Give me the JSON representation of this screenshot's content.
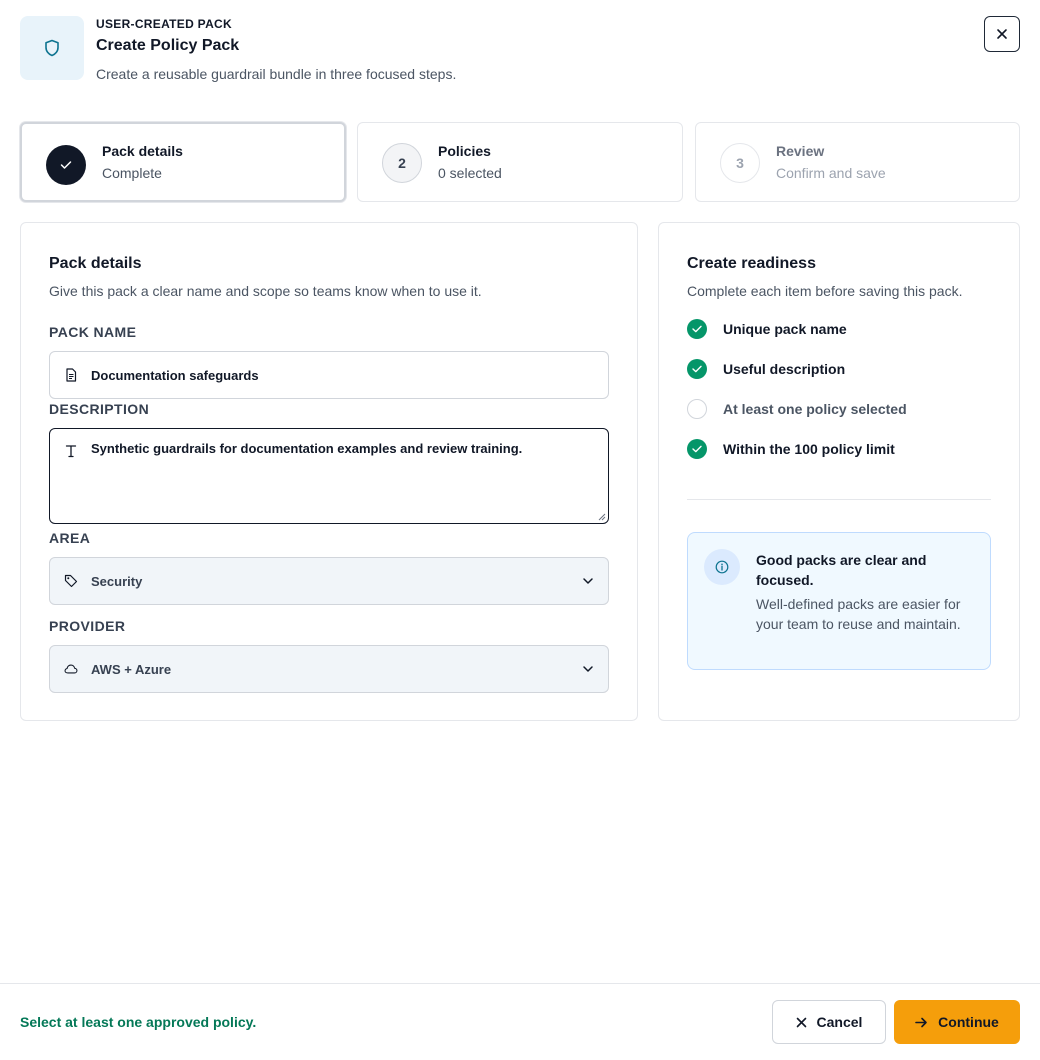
{
  "header": {
    "eyebrow": "USER-CREATED PACK",
    "title": "Create Policy Pack",
    "subtitle": "Create a reusable guardrail bundle in three focused steps."
  },
  "steps": [
    {
      "title": "Pack details",
      "status": "Complete",
      "state": "complete"
    },
    {
      "number": "2",
      "title": "Policies",
      "status": "0 selected",
      "state": "upcoming"
    },
    {
      "number": "3",
      "title": "Review",
      "status": "Confirm and save",
      "state": "disabled"
    }
  ],
  "pack_details": {
    "title": "Pack details",
    "subtitle": "Give this pack a clear name and scope so teams know when to use it.",
    "name_label": "PACK NAME",
    "name_value": "Documentation safeguards",
    "description_label": "DESCRIPTION",
    "description_value": "Synthetic guardrails for documentation examples and review training.",
    "area_label": "AREA",
    "area_value": "Security",
    "provider_label": "PROVIDER",
    "provider_value": "AWS + Azure"
  },
  "readiness": {
    "title": "Create readiness",
    "subtitle": "Complete each item before saving this pack.",
    "items": [
      {
        "label": "Unique pack name",
        "done": true
      },
      {
        "label": "Useful description",
        "done": true
      },
      {
        "label": "At least one policy selected",
        "done": false
      },
      {
        "label": "Within the 100 policy limit",
        "done": true
      }
    ],
    "tip_title": "Good packs are clear and focused.",
    "tip_body": "Well-defined packs are easier for your team to reuse and maintain."
  },
  "footer": {
    "message": "Select at least one approved policy.",
    "cancel_label": "Cancel",
    "continue_label": "Continue"
  },
  "colors": {
    "accent": "#f59e0b",
    "success": "#059669",
    "dark": "#111827",
    "info_bg": "#f0f9ff"
  }
}
